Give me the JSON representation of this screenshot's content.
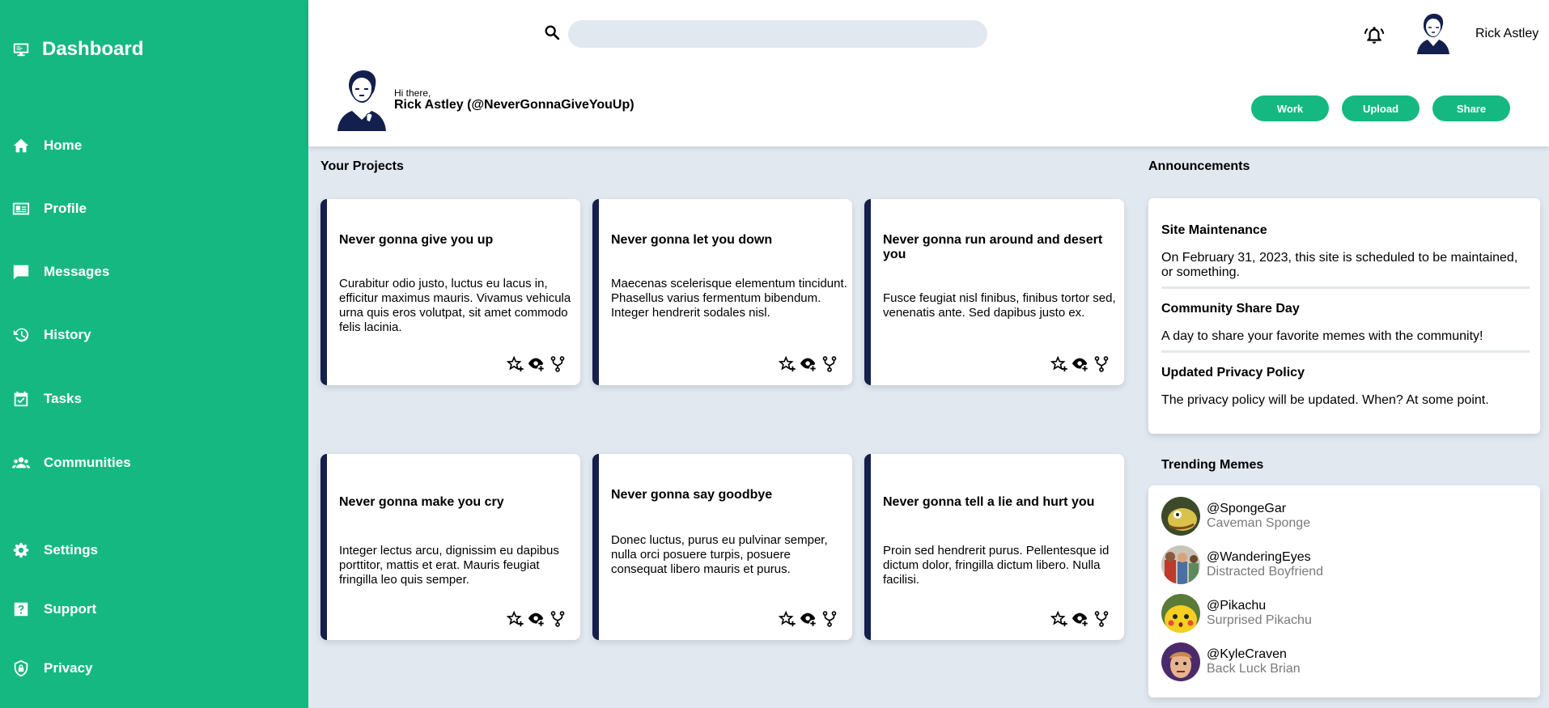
{
  "sidebar": {
    "brand": {
      "label": "Dashboard",
      "icon": "monitor-icon"
    },
    "items": [
      {
        "label": "Home",
        "icon": "home-icon"
      },
      {
        "label": "Profile",
        "icon": "id-card-icon"
      },
      {
        "label": "Messages",
        "icon": "chat-icon"
      },
      {
        "label": "History",
        "icon": "history-icon"
      },
      {
        "label": "Tasks",
        "icon": "calendar-check-icon"
      },
      {
        "label": "Communities",
        "icon": "group-icon"
      },
      {
        "label": "Settings",
        "icon": "gear-icon"
      },
      {
        "label": "Support",
        "icon": "help-icon"
      },
      {
        "label": "Privacy",
        "icon": "shield-lock-icon"
      }
    ]
  },
  "header": {
    "search": {
      "placeholder": "",
      "value": ""
    },
    "user_name": "Rick Astley",
    "greeting": "Hi there,",
    "greeting_name": "Rick Astley (@NeverGonnaGiveYouUp)",
    "buttons": {
      "work": "Work",
      "upload": "Upload",
      "share": "Share"
    }
  },
  "projects": {
    "title": "Your Projects",
    "cards": [
      {
        "title": "Never gonna give you up",
        "body": "Curabitur odio justo, luctus eu lacus in, efficitur maximus mauris. Vivamus vehicula urna quis eros volutpat, sit amet commodo felis lacinia."
      },
      {
        "title": "Never gonna let you down",
        "body": "Maecenas scelerisque elementum tincidunt. Phasellus varius fermentum bibendum. Integer hendrerit sodales nisl."
      },
      {
        "title": "Never gonna run around and desert you",
        "body": "Fusce feugiat nisl finibus, finibus tortor sed, venenatis ante. Sed dapibus justo ex."
      },
      {
        "title": "Never gonna make you cry",
        "body": "Integer lectus arcu, dignissim eu dapibus porttitor, mattis et erat. Mauris feugiat fringilla leo quis semper."
      },
      {
        "title": "Never gonna say goodbye",
        "body": "Donec luctus, purus eu pulvinar semper, nulla orci posuere turpis, posuere consequat libero mauris et purus."
      },
      {
        "title": "Never gonna tell a lie and hurt you",
        "body": "Proin sed hendrerit purus. Pellentesque id dictum dolor, fringilla dictum libero. Nulla facilisi."
      }
    ],
    "action_icons": [
      "star-add-icon",
      "watch-add-icon",
      "fork-icon"
    ]
  },
  "announcements": {
    "title": "Announcements",
    "items": [
      {
        "title": "Site Maintenance",
        "text": "On February 31, 2023, this site is scheduled to be maintained, or something."
      },
      {
        "title": "Community Share Day",
        "text": "A day to share your favorite memes with the community!"
      },
      {
        "title": "Updated Privacy Policy",
        "text": "The privacy policy will be updated. When? At some point."
      }
    ]
  },
  "trending": {
    "title": "Trending Memes",
    "items": [
      {
        "handle": "@SpongeGar",
        "name": "Caveman Sponge"
      },
      {
        "handle": "@WanderingEyes",
        "name": "Distracted Boyfriend"
      },
      {
        "handle": "@Pikachu",
        "name": "Surprised Pikachu"
      },
      {
        "handle": "@KyleCraven",
        "name": "Back Luck Brian"
      }
    ]
  },
  "colors": {
    "accent": "#16b882",
    "card_border": "#13204d",
    "background": "#e2e8f0"
  }
}
